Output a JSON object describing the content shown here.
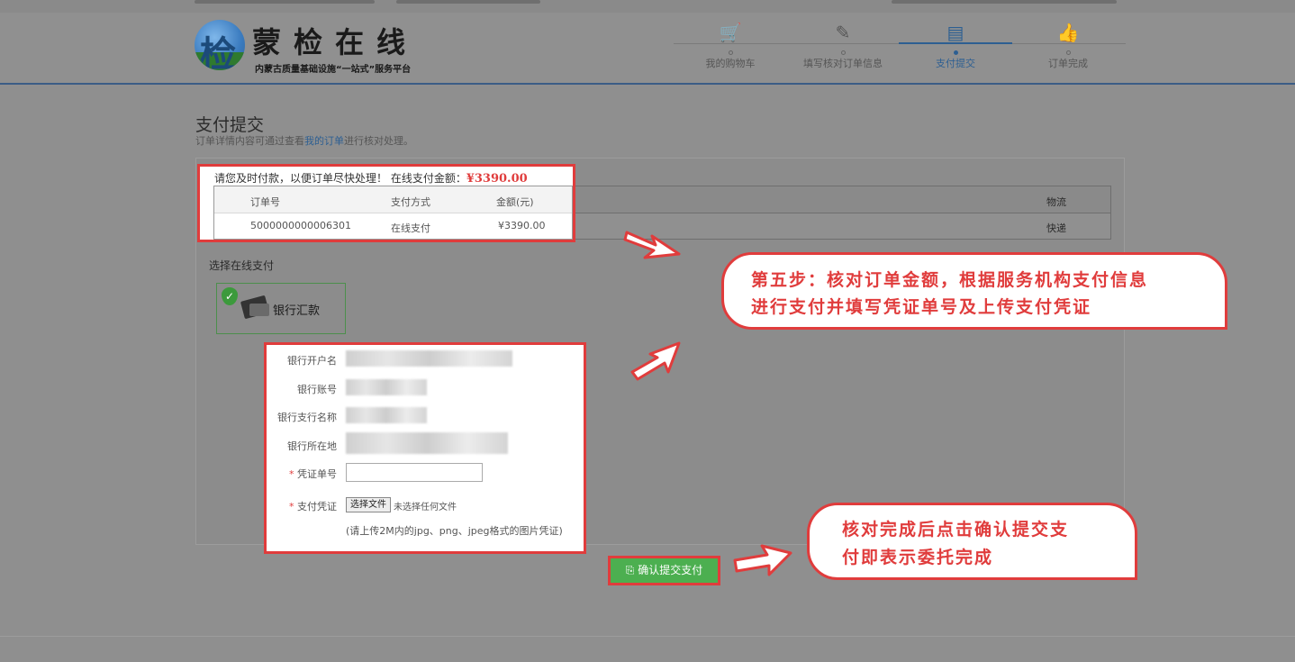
{
  "header": {
    "logo_char": "检",
    "title": "蒙检在线",
    "subtitle": "内蒙古质量基础设施“一站式”服务平台"
  },
  "steps": [
    {
      "label": "我的购物车",
      "icon": "cart-icon",
      "glyph": "🛒"
    },
    {
      "label": "填写核对订单信息",
      "icon": "pencil-icon",
      "glyph": "✎"
    },
    {
      "label": "支付提交",
      "icon": "card-icon",
      "glyph": "▤",
      "active": true
    },
    {
      "label": "订单完成",
      "icon": "thumbs-up-icon",
      "glyph": "👍"
    }
  ],
  "page": {
    "title": "支付提交",
    "hint_before": "订单详情内容可通过查看",
    "hint_link": "我的订单",
    "hint_after": "进行核对处理。"
  },
  "notice": {
    "message": "请您及时付款，以便订单尽快处理！ 在线支付金额：",
    "amount": "¥3390.00"
  },
  "order_table": {
    "headers": [
      "订单号",
      "支付方式",
      "金额(元)",
      "物流"
    ],
    "row": [
      "5000000000006301",
      "在线支付",
      "¥3390.00",
      "快递"
    ]
  },
  "payment": {
    "section_label": "选择在线支付",
    "method_label": "银行汇款"
  },
  "form": {
    "bank_account_name_label": "银行开户名",
    "bank_account_no_label": "银行账号",
    "bank_branch_label": "银行支行名称",
    "bank_location_label": "银行所在地",
    "voucher_no_label": "凭证单号",
    "voucher_file_label": "支付凭证",
    "required_mark": "*",
    "file_button": "选择文件",
    "no_file": "未选择任何文件",
    "tip": "(请上传2M内的jpg、png、jpeg格式的图片凭证)"
  },
  "submit_button": "确认提交支付",
  "callouts": {
    "step5_line1": "第五步：核对订单金额，根据服务机构支付信息",
    "step5_line2": "进行支付并填写凭证单号及上传支付凭证",
    "confirm_line1": "核对完成后点击确认提交支",
    "confirm_line2": "付即表示委托完成"
  },
  "colors": {
    "accent_red": "#e03c3c",
    "brand_blue": "#2d5f92",
    "submit_green": "#4caf50"
  }
}
